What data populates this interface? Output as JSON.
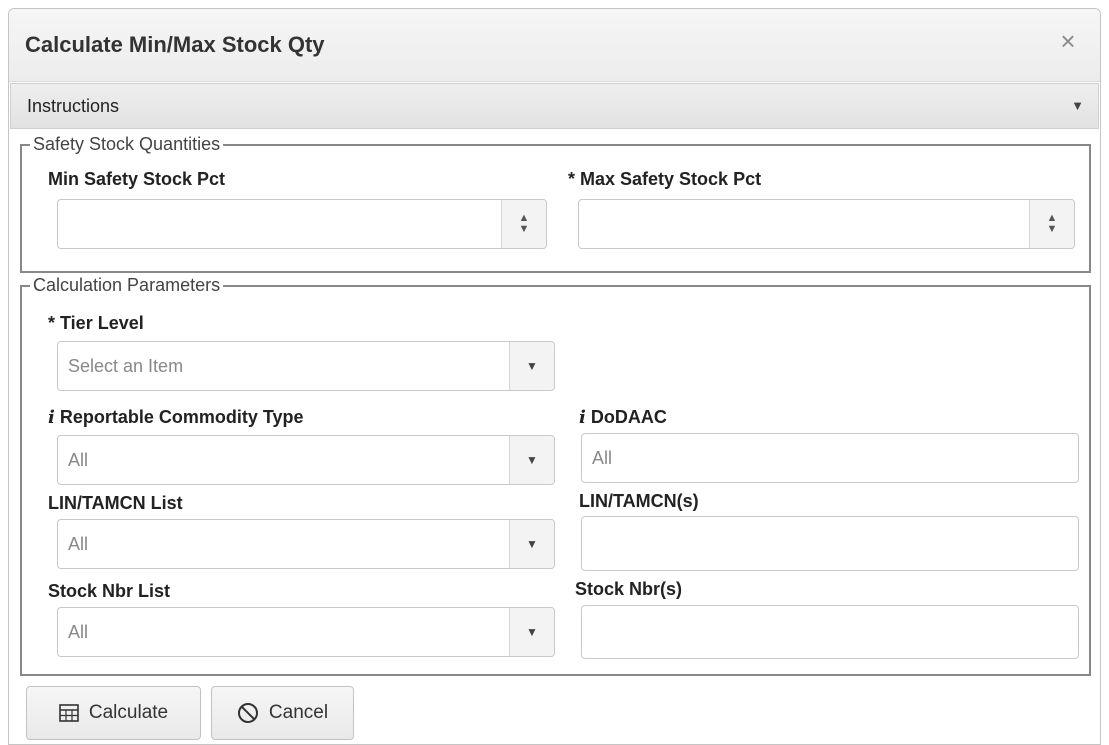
{
  "dialog": {
    "title": "Calculate Min/Max Stock Qty",
    "close_glyph": "×",
    "close_icon": "close-icon"
  },
  "instructions": {
    "label": "Instructions",
    "caret": "▼"
  },
  "safety_stock": {
    "legend": "Safety Stock Quantities",
    "min_label": "Min Safety Stock Pct",
    "min_value": "",
    "max_label": "* Max Safety Stock Pct",
    "max_value": ""
  },
  "calc_params": {
    "legend": "Calculation Parameters",
    "tier_level": {
      "label": "* Tier Level",
      "value": "Select an Item"
    },
    "commodity_type": {
      "info": "i",
      "label": "Reportable Commodity Type",
      "value": "All"
    },
    "dodaac": {
      "info": "i",
      "label": "DoDAAC",
      "placeholder": "All"
    },
    "lin_list": {
      "label": "LIN/TAMCN List",
      "value": "All"
    },
    "lins": {
      "label": "LIN/TAMCN(s)",
      "value": ""
    },
    "stock_list": {
      "label": "Stock Nbr List",
      "value": "All"
    },
    "stock_nbrs": {
      "label": "Stock Nbr(s)",
      "value": ""
    }
  },
  "icons": {
    "spinner_up": "▲",
    "spinner_down": "▼",
    "dropdown": "▼",
    "calculate": "calculator-icon",
    "cancel": "ban-icon"
  },
  "footer": {
    "calculate_label": "Calculate",
    "cancel_label": "Cancel"
  }
}
